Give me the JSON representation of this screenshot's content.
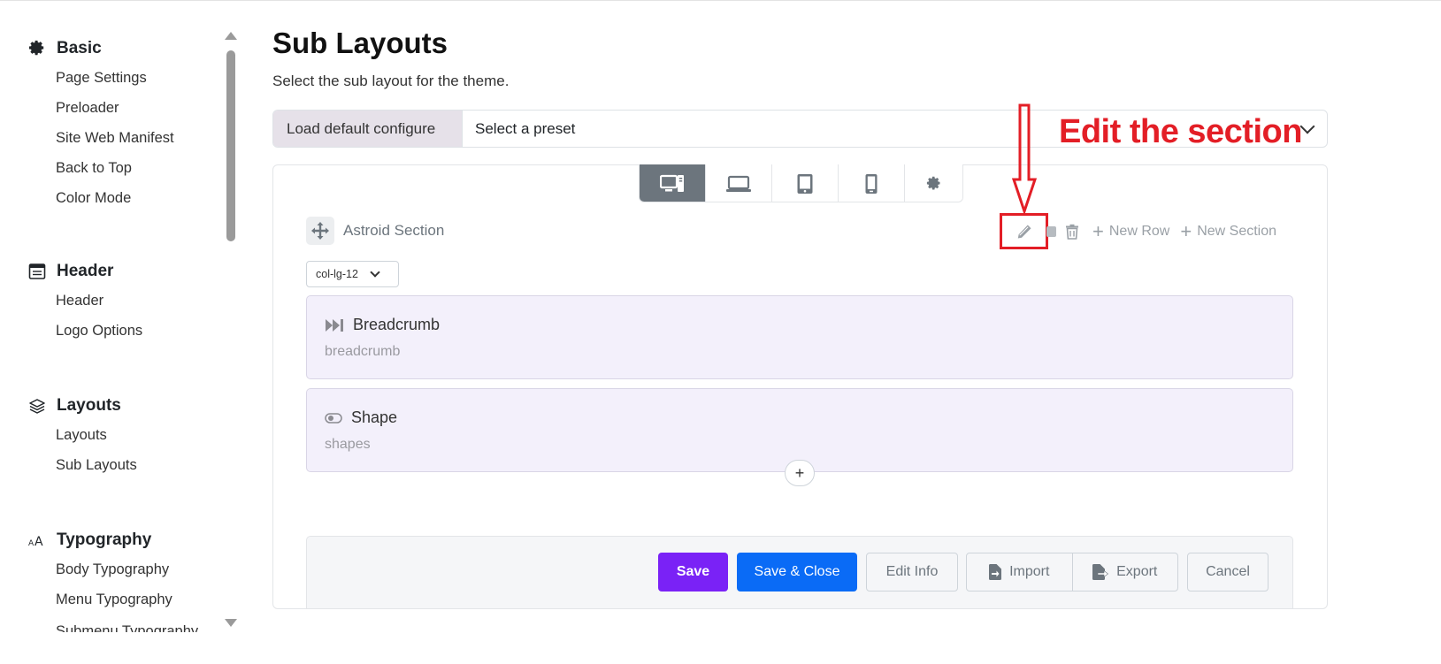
{
  "sidebar": {
    "groups": [
      {
        "title": "Basic",
        "icon": "gear-icon",
        "items": [
          "Page Settings",
          "Preloader",
          "Site Web Manifest",
          "Back to Top",
          "Color Mode"
        ]
      },
      {
        "title": "Header",
        "icon": "header-layout-icon",
        "items": [
          "Header",
          "Logo Options"
        ]
      },
      {
        "title": "Layouts",
        "icon": "layers-icon",
        "items": [
          "Layouts",
          "Sub Layouts"
        ]
      },
      {
        "title": "Typography",
        "icon": "font-size-icon",
        "items": [
          "Body Typography",
          "Menu Typography",
          "Submenu Typography"
        ]
      }
    ]
  },
  "main": {
    "title": "Sub Layouts",
    "subtitle": "Select the sub layout for the theme.",
    "preset": {
      "label": "Load default configure",
      "placeholder": "Select a preset"
    },
    "annotation": "Edit the section",
    "devices": [
      "desktop-icon",
      "laptop-icon",
      "tablet-icon",
      "mobile-icon",
      "gear-icon"
    ],
    "section": {
      "name": "Astroid Section",
      "column": "col-lg-12",
      "new_row": "New Row",
      "new_section": "New Section",
      "elements": [
        {
          "title": "Breadcrumb",
          "type": "breadcrumb",
          "icon": "forward-step-icon"
        },
        {
          "title": "Shape",
          "type": "shapes",
          "icon": "toggle-icon"
        }
      ]
    },
    "footer": {
      "save": "Save",
      "save_close": "Save & Close",
      "edit_info": "Edit Info",
      "import": "Import",
      "export": "Export",
      "cancel": "Cancel"
    }
  },
  "colors": {
    "accent_purple": "#7a22f6",
    "primary_blue": "#0a6bf6",
    "annotation_red": "#e31e26",
    "element_bg": "#f3f0fb"
  }
}
